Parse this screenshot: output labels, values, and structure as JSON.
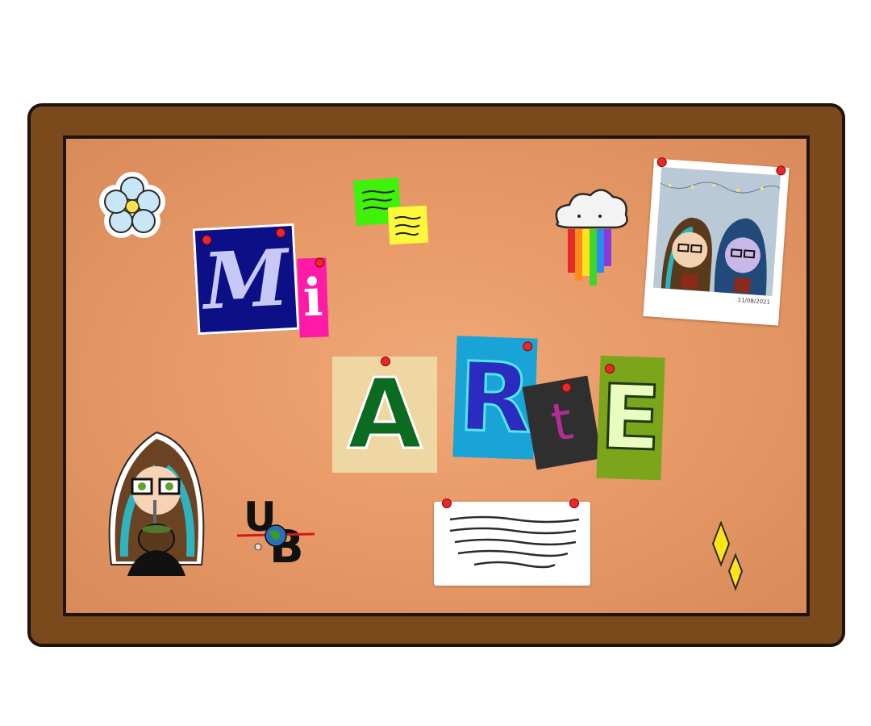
{
  "title": {
    "word1": [
      "M",
      "i"
    ],
    "word2": [
      "A",
      "R",
      "t",
      "E"
    ]
  },
  "polaroid": {
    "date": "11/08/2021"
  },
  "logo": {
    "letters": [
      "U",
      "B"
    ]
  },
  "colors": {
    "frame": "#7a4a1c",
    "cork": "#e89a68",
    "pin": "#e8282a"
  },
  "icons": [
    "flower-icon",
    "sticky-notes-icon",
    "rainbow-cloud-icon",
    "polaroid-photo",
    "avatar-sticker",
    "ub-globe-logo",
    "paper-note",
    "sparkle-icon"
  ]
}
